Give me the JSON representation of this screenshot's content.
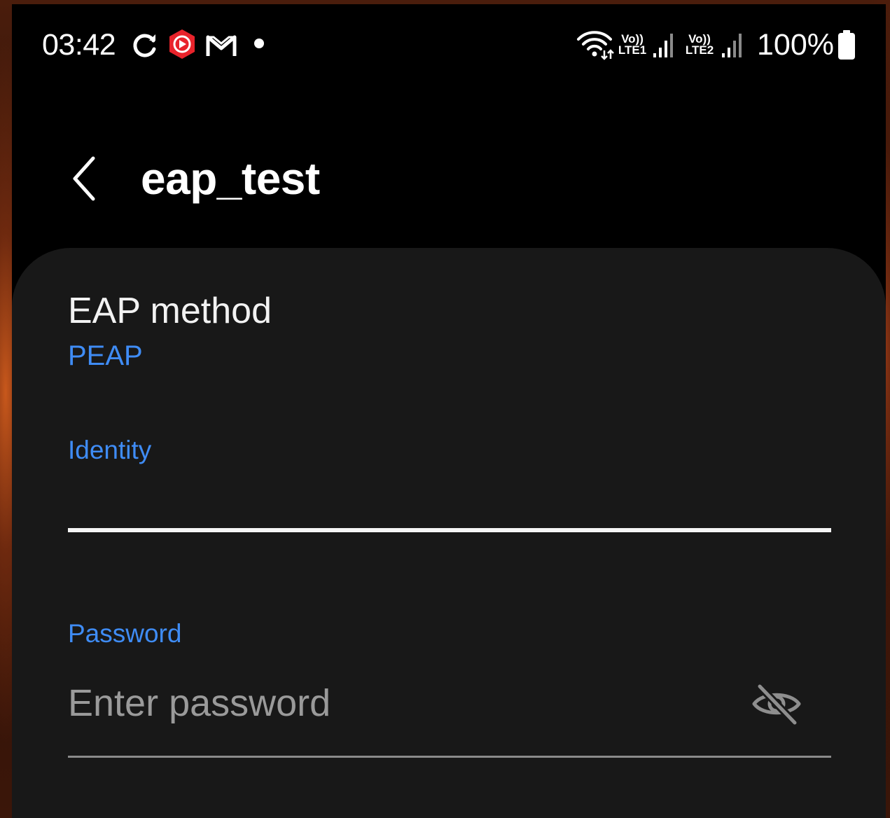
{
  "status_bar": {
    "time": "03:42",
    "icons": [
      "sync-icon",
      "youtube-music-icon",
      "gmail-icon",
      "notification-dot-icon",
      "wifi-icon",
      "volte-sim1-icon",
      "signal-sim1-icon",
      "volte-sim2-icon",
      "signal-sim2-icon",
      "battery-icon"
    ],
    "volte_top": "Vo))",
    "lte1": "LTE1",
    "lte2": "LTE2",
    "battery": "100%"
  },
  "header": {
    "title": "eap_test"
  },
  "form": {
    "eap_method_label": "EAP method",
    "eap_method_value": "PEAP",
    "identity_label": "Identity",
    "identity_value": "",
    "password_label": "Password",
    "password_placeholder": "Enter password"
  },
  "colors": {
    "accent": "#3f8cf5",
    "card": "#181818",
    "background": "#000000"
  }
}
